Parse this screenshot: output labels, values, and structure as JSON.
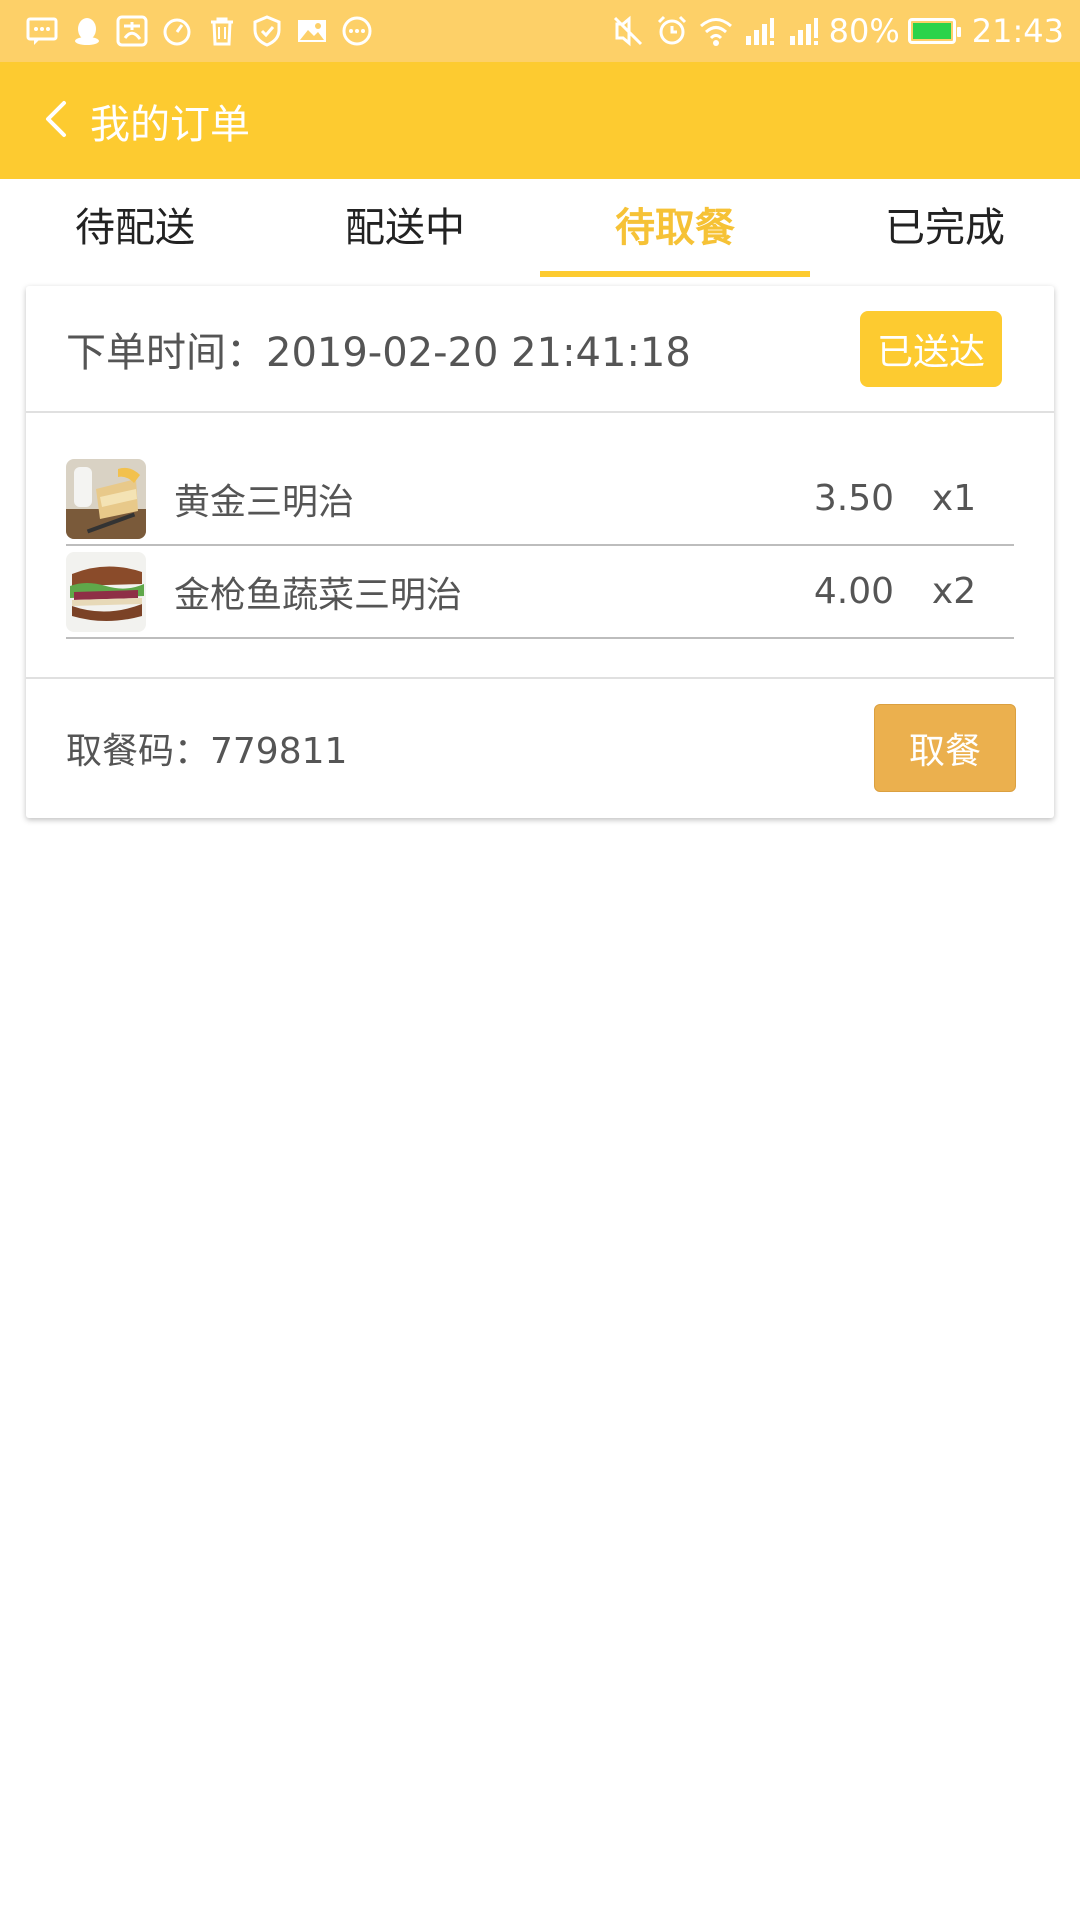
{
  "status_bar": {
    "battery": "80%",
    "time": "21:43",
    "battery_color": "#2bd34a",
    "icons_left": [
      "message-icon",
      "qq-penguin-icon",
      "alipay-icon",
      "stopwatch-icon",
      "trash-icon",
      "shield-icon",
      "image-icon",
      "chat-bubble-icon"
    ],
    "icons_right": [
      "mute-icon",
      "alarm-icon",
      "wifi-icon",
      "signal-icon",
      "signal-icon"
    ]
  },
  "header": {
    "title": "我的订单",
    "color": "#fdcb30"
  },
  "tabs": [
    {
      "label": "待配送",
      "active": false
    },
    {
      "label": "配送中",
      "active": false
    },
    {
      "label": "待取餐",
      "active": true
    },
    {
      "label": "已完成",
      "active": false
    }
  ],
  "order": {
    "time_label": "下单时间：2019-02-20 21:41:18",
    "status": "已送达",
    "items": [
      {
        "name": "黄金三明治",
        "price": "3.50",
        "qty": "x1",
        "thumb": "sandwich-thumbnail"
      },
      {
        "name": "金枪鱼蔬菜三明治",
        "price": "4.00",
        "qty": "x2",
        "thumb": "tuna-sandwich-thumbnail"
      }
    ],
    "pickup_code_label": "取餐码：779811",
    "pickup_button": "取餐"
  }
}
